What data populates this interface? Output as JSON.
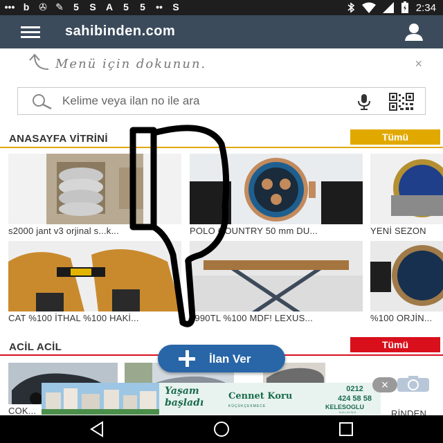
{
  "status_bar": {
    "left_icons": [
      "chat-bubble-icon",
      "b-icon",
      "bike-icon",
      "wrench-icon",
      "badge-icon",
      "s-icon",
      "a-icon",
      "badge-icon",
      "badge-icon",
      "ladybug-icon",
      "s-icon"
    ],
    "left_glyphs": [
      "•••",
      "b",
      "✇",
      "✎",
      "5",
      "S",
      "A",
      "5",
      "5",
      "••",
      "S"
    ],
    "time": "2:34"
  },
  "app_bar": {
    "title": "sahibinden.com",
    "background": "#3b4b5c"
  },
  "hint": {
    "text": "Menü için dokunun.",
    "close": "×"
  },
  "search": {
    "placeholder": "Kelime veya ilan no ile ara"
  },
  "vitrin": {
    "title": "ANASAYFA VİTRİNİ",
    "all_label": "Tümü",
    "accent": "#e1a900",
    "items": [
      {
        "caption": "s2000 jant v3 orjinal s...k..."
      },
      {
        "caption": "POLO COUNTRY 50 mm DU..."
      },
      {
        "caption": "YENİ SEZON"
      },
      {
        "caption": "CAT %100 İTHAL %100 HAKİ..."
      },
      {
        "caption": "1990TL %100 MDF! LEXUS..."
      },
      {
        "caption": "%100 ORJİN..."
      }
    ]
  },
  "acil": {
    "title": "ACİL ACİL",
    "all_label": "Tümü",
    "accent": "#d9101c",
    "items": [
      {
        "caption": "COK..."
      },
      {
        "caption": ""
      },
      {
        "caption": ""
      },
      {
        "caption": "RİNDEN"
      }
    ]
  },
  "fab": {
    "label": "İlan Ver",
    "color": "#2866a8"
  },
  "ad": {
    "tagline_line1": "Yaşam",
    "tagline_line2": "başladı",
    "brand": "Cennet Koru",
    "brand_sub": "KÜÇÜKÇEKMECE",
    "phone_line1": "0212",
    "phone_line2": "424 58 58",
    "developer": "KELESOGLU",
    "developer_sub": "HOLDING",
    "close": "×"
  }
}
